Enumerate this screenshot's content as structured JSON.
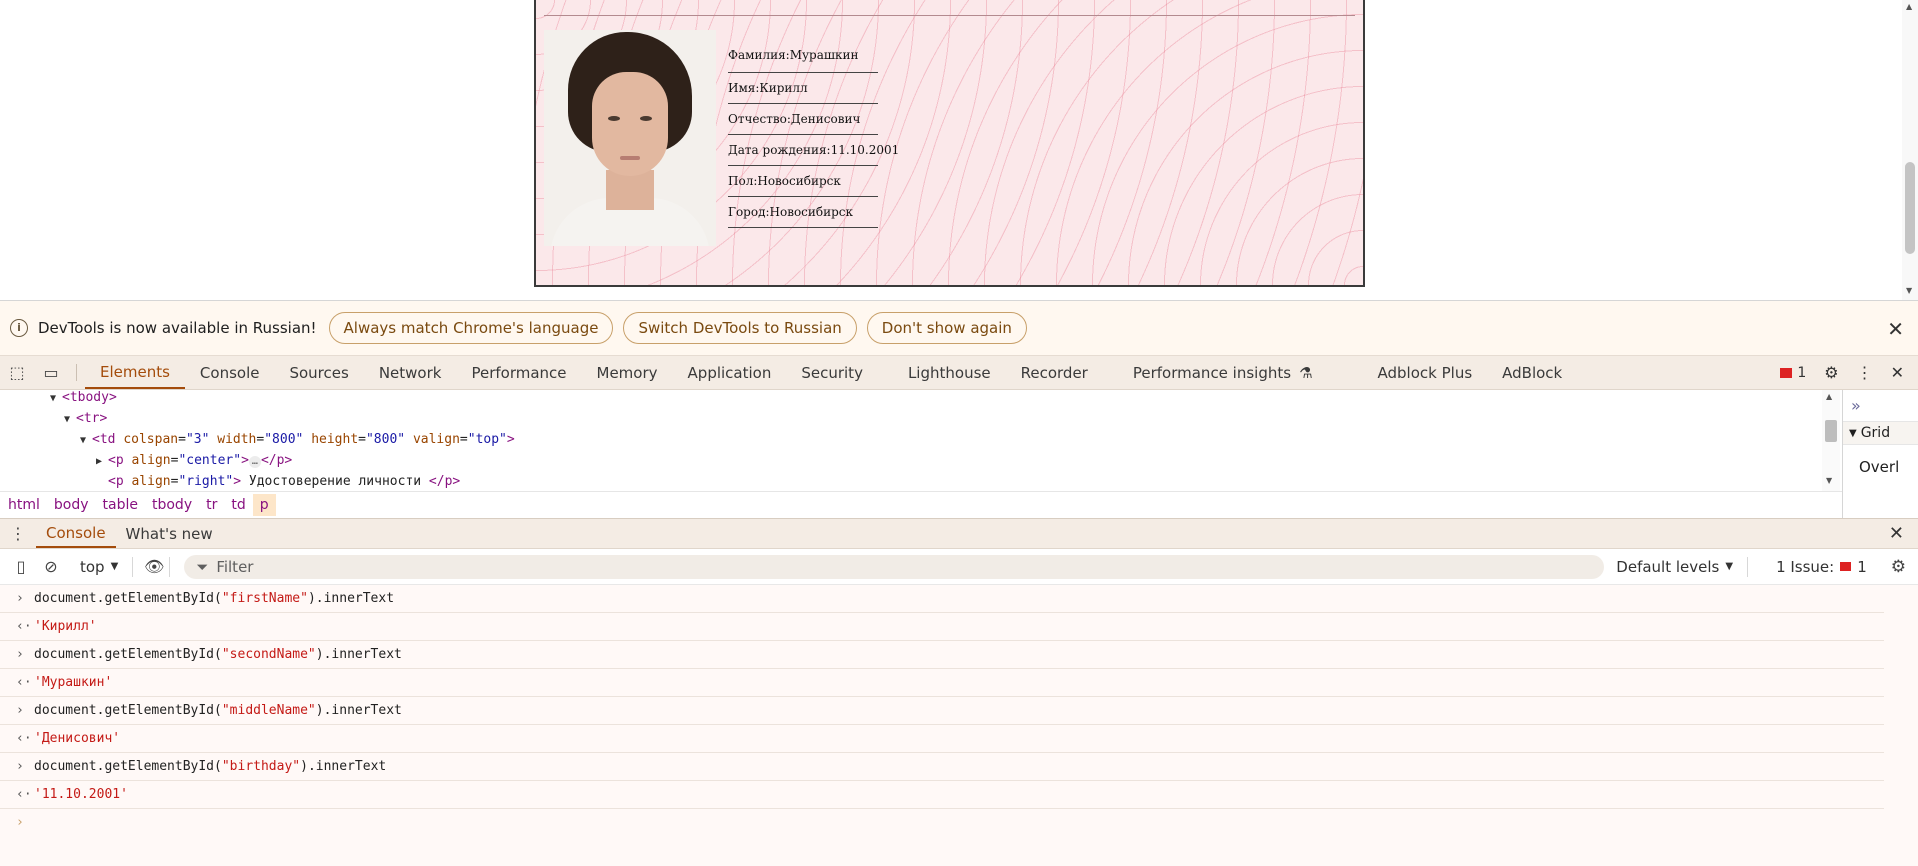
{
  "page": {
    "fields": [
      {
        "label": "Фамилия:",
        "value": "Мурашкин"
      },
      {
        "label": "Имя:",
        "value": "Кирилл"
      },
      {
        "label": "Отчество:",
        "value": "Денисович"
      },
      {
        "label": "Дата рождения:",
        "value": "11.10.2001"
      },
      {
        "label": "Пол:",
        "value": "Новосибирск"
      },
      {
        "label": "Город:",
        "value": "Новосибирск"
      }
    ]
  },
  "infobar": {
    "message": "DevTools is now available in Russian!",
    "btn_match": "Always match Chrome's language",
    "btn_switch": "Switch DevTools to Russian",
    "btn_dismiss": "Don't show again"
  },
  "tabs": [
    "Elements",
    "Console",
    "Sources",
    "Network",
    "Performance",
    "Memory",
    "Application",
    "Security",
    "Lighthouse",
    "Recorder",
    "Performance insights",
    "Adblock Plus",
    "AdBlock"
  ],
  "issues_count": "1",
  "elements": {
    "tbody": "<tbody>",
    "tr": "<tr>",
    "td_open": "<td",
    "td_a1": "colspan",
    "td_v1": "\"3\"",
    "td_a2": "width",
    "td_v2": "\"800\"",
    "td_a3": "height",
    "td_v3": "\"800\"",
    "td_a4": "valign",
    "td_v4": "\"top\"",
    "td_close": ">",
    "p1_open": "<p",
    "p1_a": "align",
    "p1_v": "\"center\"",
    "p1_gt": ">",
    "p1_ell": "…",
    "p1_close": "</p>",
    "p2_open": "<p",
    "p2_a": "align",
    "p2_v": "\"right\"",
    "p2_gt": ">",
    "p2_text": " Удостоверение личности ",
    "p2_close": "</p>",
    "eq": "="
  },
  "breadcrumbs": [
    "html",
    "body",
    "table",
    "tbody",
    "tr",
    "td",
    "p"
  ],
  "sidepane": {
    "section": "Grid",
    "overlay": "Overl"
  },
  "drawer": {
    "tab_console": "Console",
    "tab_whats_new": "What's new"
  },
  "console_toolbar": {
    "context": "top",
    "filter_placeholder": "Filter",
    "levels": "Default levels",
    "issues_label": "1 Issue:",
    "issues_count": "1"
  },
  "console": [
    {
      "kind": "in",
      "pre": "document.getElementById(",
      "arg": "\"firstName\"",
      "post": ").innerText"
    },
    {
      "kind": "out",
      "value": "'Кирилл'"
    },
    {
      "kind": "in",
      "pre": "document.getElementById(",
      "arg": "\"secondName\"",
      "post": ").innerText"
    },
    {
      "kind": "out",
      "value": "'Мурашкин'"
    },
    {
      "kind": "in",
      "pre": "document.getElementById(",
      "arg": "\"middleName\"",
      "post": ").innerText"
    },
    {
      "kind": "out",
      "value": "'Денисович'"
    },
    {
      "kind": "in",
      "pre": "document.getElementById(",
      "arg": "\"birthday\"",
      "post": ").innerText"
    },
    {
      "kind": "out",
      "value": "'11.10.2001'"
    }
  ],
  "colors": {
    "accent": "#a44c0b",
    "string": "#c41a16",
    "tag": "#881280"
  }
}
